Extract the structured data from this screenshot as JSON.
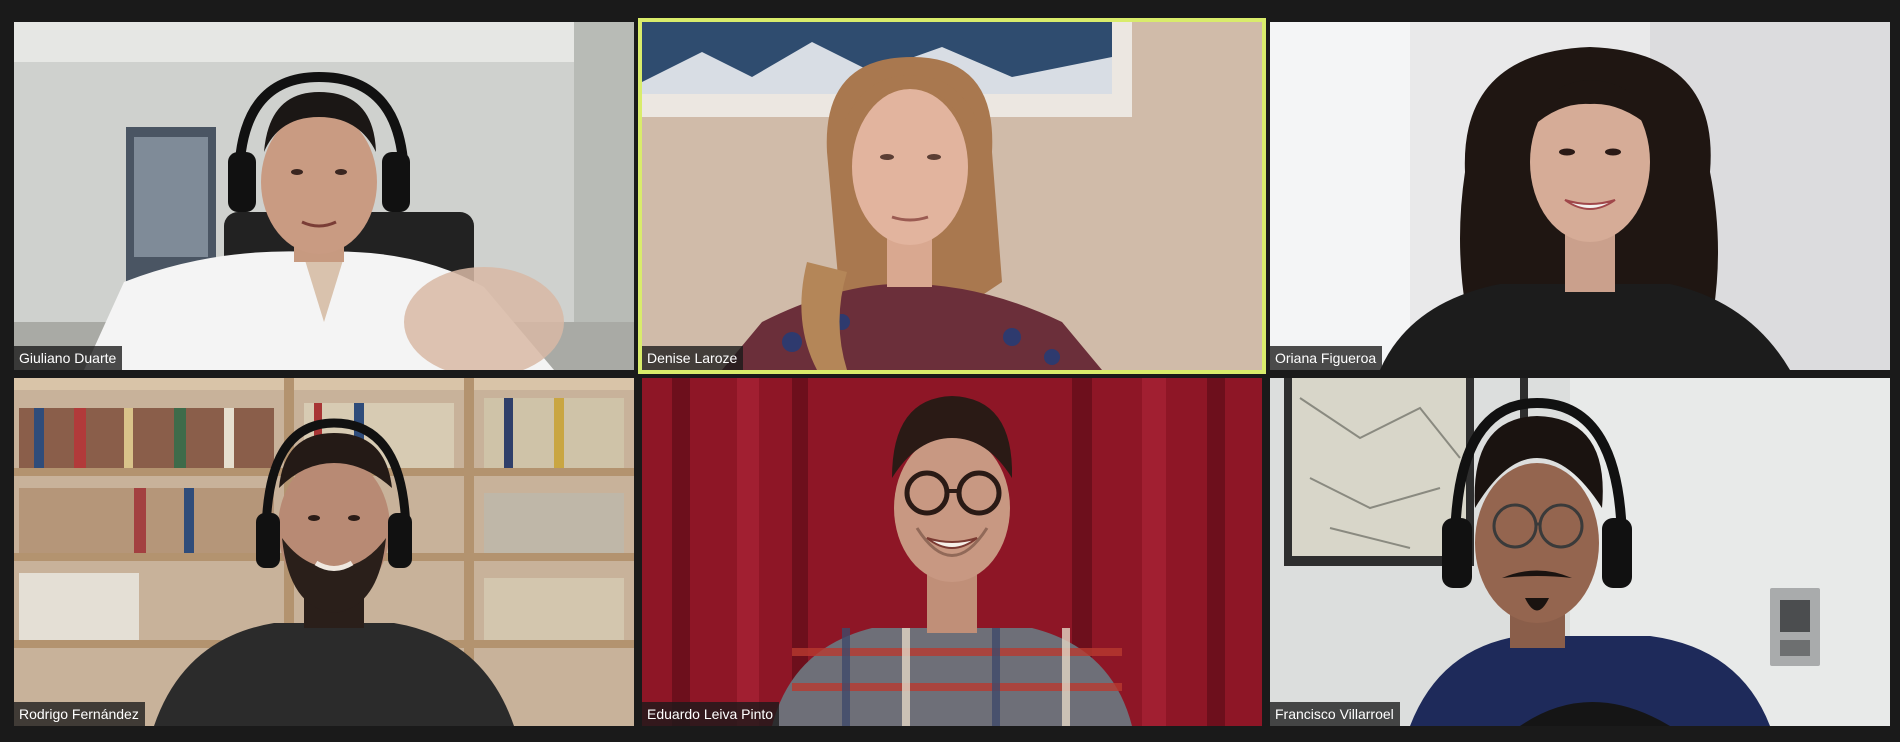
{
  "meeting": {
    "layout": "gallery",
    "active_speaker_color": "#d9ec6b"
  },
  "participants": [
    {
      "name": "Giuliano Duarte",
      "active_speaker": false,
      "background": "white room with framed cityscape photo",
      "clothing_color": "#f4f4f4",
      "headphones": true
    },
    {
      "name": "Denise Laroze",
      "active_speaker": true,
      "background": "beige wall with framed mountain photo",
      "clothing_color": "#6b2f3a",
      "headphones": false
    },
    {
      "name": "Oriana Figueroa",
      "active_speaker": false,
      "background": "bright white wall",
      "clothing_color": "#1c1c1c",
      "headphones": false
    },
    {
      "name": "Rodrigo Fernández",
      "active_speaker": false,
      "background": "wooden bookshelf with books",
      "clothing_color": "#2b2b2b",
      "headphones": true
    },
    {
      "name": "Eduardo Leiva Pinto",
      "active_speaker": false,
      "background": "red curtain",
      "clothing_color": "#6e6f78",
      "headphones": false
    },
    {
      "name": "Francisco Villarroel",
      "active_speaker": false,
      "background": "white wall with map and light switch",
      "clothing_color": "#1e2a5a",
      "headphones": true
    }
  ]
}
